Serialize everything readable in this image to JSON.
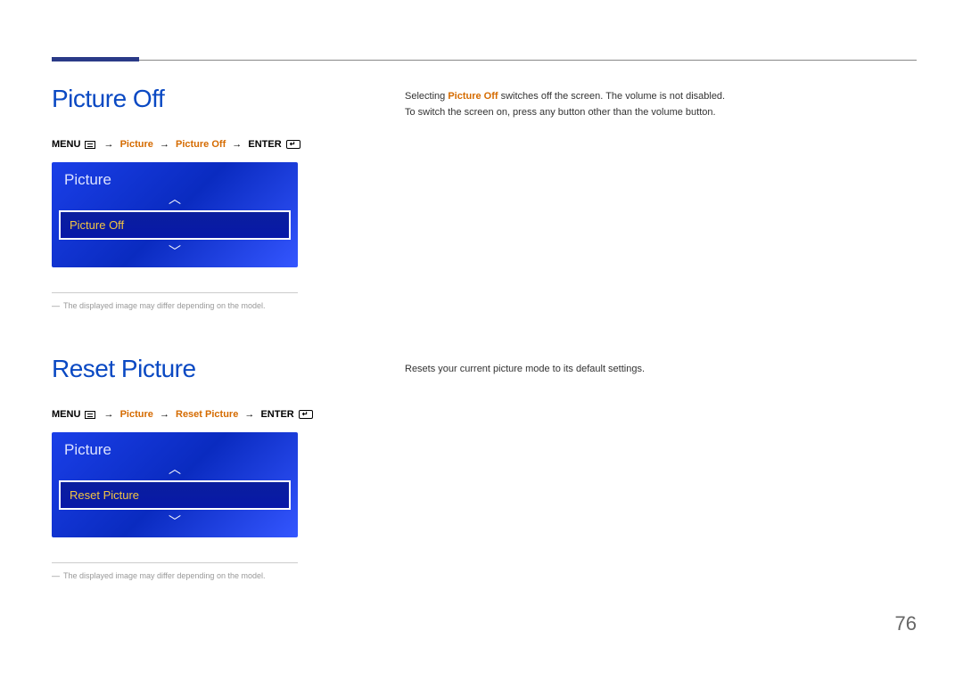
{
  "section1": {
    "title": "Picture Off",
    "breadcrumb": {
      "menu": "MENU",
      "picture": "Picture",
      "item": "Picture Off",
      "enter": "ENTER"
    },
    "menubox": {
      "title": "Picture",
      "selected": "Picture Off"
    },
    "note": "The displayed image may differ depending on the model.",
    "body_prefix": "Selecting ",
    "body_highlight": "Picture Off",
    "body_suffix": " switches off the screen. The volume is not disabled.",
    "body_line2": "To switch the screen on, press any button other than the volume button."
  },
  "section2": {
    "title": "Reset Picture",
    "breadcrumb": {
      "menu": "MENU",
      "picture": "Picture",
      "item": "Reset Picture",
      "enter": "ENTER"
    },
    "menubox": {
      "title": "Picture",
      "selected": "Reset Picture"
    },
    "note": "The displayed image may differ depending on the model.",
    "body": "Resets your current picture mode to its default settings."
  },
  "arrows": {
    "up": "︿",
    "down": "﹀",
    "right": "→"
  },
  "page_number": "76"
}
